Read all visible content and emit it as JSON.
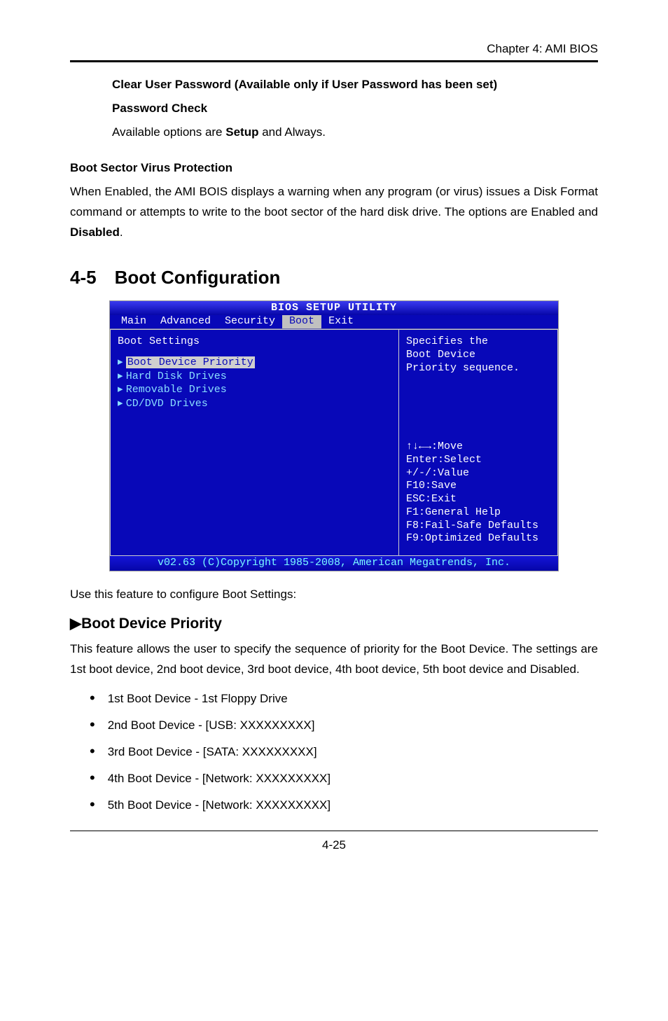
{
  "chapter_header": "Chapter 4: AMI BIOS",
  "clear_user_pw": "Clear User Password (Available only if User Password has been set)",
  "password_check_h": "Password Check",
  "password_check_p_pre": "Available options are ",
  "password_check_setup": "Setup",
  "password_check_p_post": " and Always.",
  "bsvp_h": "Boot Sector Virus Protection",
  "bsvp_p_pre": "When Enabled, the AMI BOIS displays a warning when any program (or virus) issues a Disk Format command or attempts to write to the boot sector of the hard disk drive. The options are Enabled and ",
  "bsvp_disabled": "Disabled",
  "sec_num": "4-5",
  "sec_title": "Boot Configuration",
  "bios": {
    "title": "BIOS SETUP UTILITY",
    "tabs": [
      "Main",
      "Advanced",
      "Security",
      "Boot",
      "Exit"
    ],
    "active_tab_index": 3,
    "left_heading": "Boot Settings",
    "menu": [
      "Boot Device Priority",
      "Hard Disk Drives",
      "Removable Drives",
      "CD/DVD Drives"
    ],
    "hint": "Specifies the\nBoot Device\nPriority sequence.",
    "keys": [
      "↑↓←→:Move",
      "Enter:Select",
      "+/-/:Value",
      "F10:Save",
      "ESC:Exit",
      "F1:General Help",
      "F8:Fail-Safe Defaults",
      "F9:Optimized Defaults"
    ],
    "copyright": "v02.63 (C)Copyright 1985-2008, American Megatrends, Inc."
  },
  "use_feature": "Use this feature to configure Boot Settings:",
  "bdp_title": "Boot Device Priority",
  "bdp_para": "This feature allows the user to specify the sequence of priority for the Boot Device. The settings are 1st boot device, 2nd boot device, 3rd boot device, 4th boot device, 5th boot device and Disabled.",
  "bullets": [
    "1st Boot Device - 1st Floppy Drive",
    "2nd Boot Device - [USB: XXXXXXXXX]",
    "3rd Boot Device - [SATA: XXXXXXXXX]",
    "4th Boot Device - [Network: XXXXXXXXX]",
    "5th Boot Device - [Network: XXXXXXXXX]"
  ],
  "page_number": "4-25"
}
